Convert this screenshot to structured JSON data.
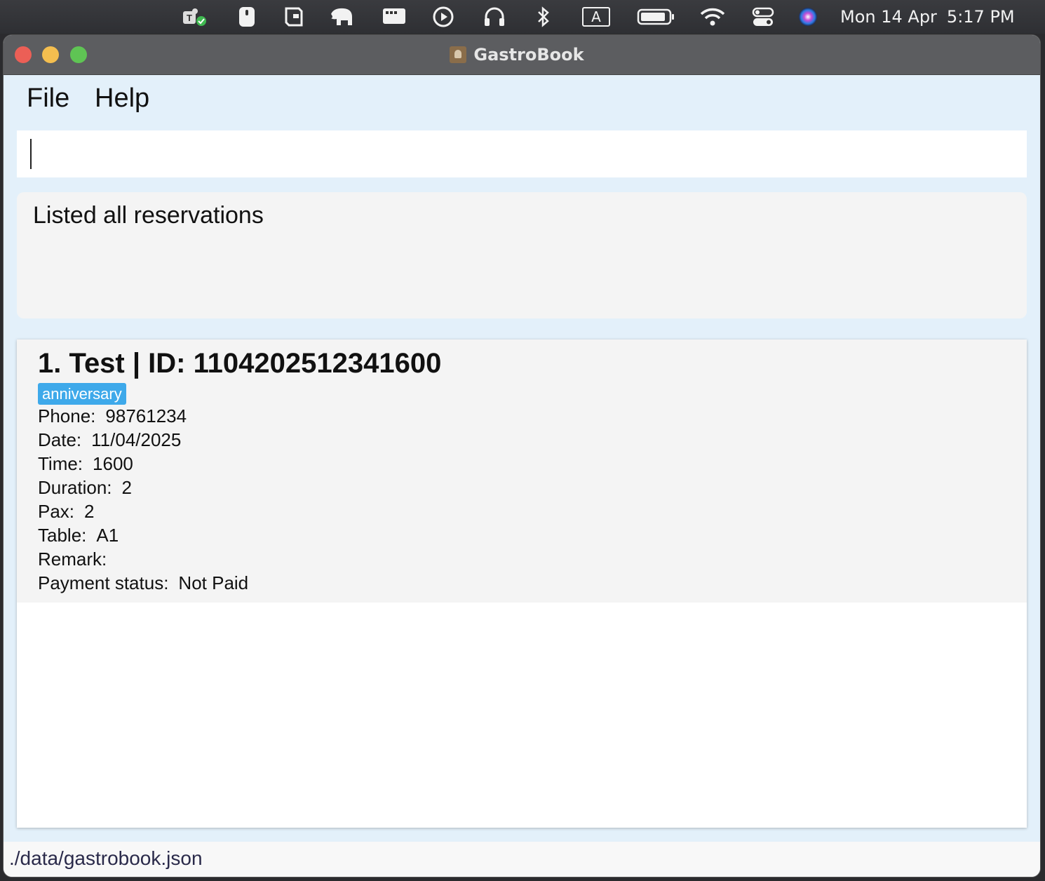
{
  "menubar": {
    "icons": [
      "teams-icon",
      "mouse-icon",
      "wallet-icon",
      "elephant-icon",
      "display-icon",
      "play-icon",
      "headphones-icon",
      "bluetooth-icon",
      "input-source-icon",
      "battery-icon",
      "wifi-icon",
      "control-center-icon",
      "siri-icon"
    ],
    "input_source": "A",
    "date": "Mon 14 Apr",
    "time": "5:17 PM"
  },
  "window": {
    "title": "GastroBook"
  },
  "app_menu": {
    "file": "File",
    "help": "Help"
  },
  "command_box": {
    "value": ""
  },
  "result": {
    "message": "Listed all reservations"
  },
  "reservations": [
    {
      "header": "1. Test | ID: 1104202512341600",
      "tag": "anniversary",
      "fields": [
        {
          "label": "Phone:",
          "value": "98761234"
        },
        {
          "label": "Date:",
          "value": "11/04/2025"
        },
        {
          "label": "Time:",
          "value": "1600"
        },
        {
          "label": "Duration:",
          "value": "2"
        },
        {
          "label": "Pax:",
          "value": "2"
        },
        {
          "label": "Table:",
          "value": "A1"
        },
        {
          "label": "Remark:",
          "value": ""
        },
        {
          "label": "Payment status:",
          "value": "Not Paid"
        }
      ]
    }
  ],
  "status_bar": {
    "path": "./data/gastrobook.json"
  },
  "colors": {
    "window_bg": "#e3f0fa",
    "tag_bg": "#3ea9ea",
    "card_bg": "#f4f4f4"
  }
}
